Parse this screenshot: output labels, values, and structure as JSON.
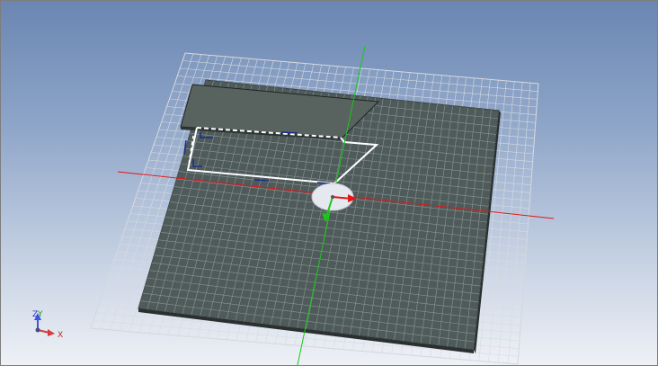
{
  "viewport": {
    "background_top": "#6a86b2",
    "background_bottom": "#eef1f6"
  },
  "colors": {
    "grid_line": "#d8dbe0",
    "plate_fill": "#4f5b5a",
    "plate_edge": "#1e2423",
    "plate_grid": "#8a9592",
    "x_axis": "#e01818",
    "y_axis": "#18c818",
    "selection": "#ffffff",
    "handle": "#e6e8ef"
  },
  "triad": {
    "z_label": "Z",
    "y_label": "Y",
    "x_label": "X",
    "z_icon": "z-axis-arrow-icon",
    "x_icon": "x-axis-arrow-icon"
  }
}
